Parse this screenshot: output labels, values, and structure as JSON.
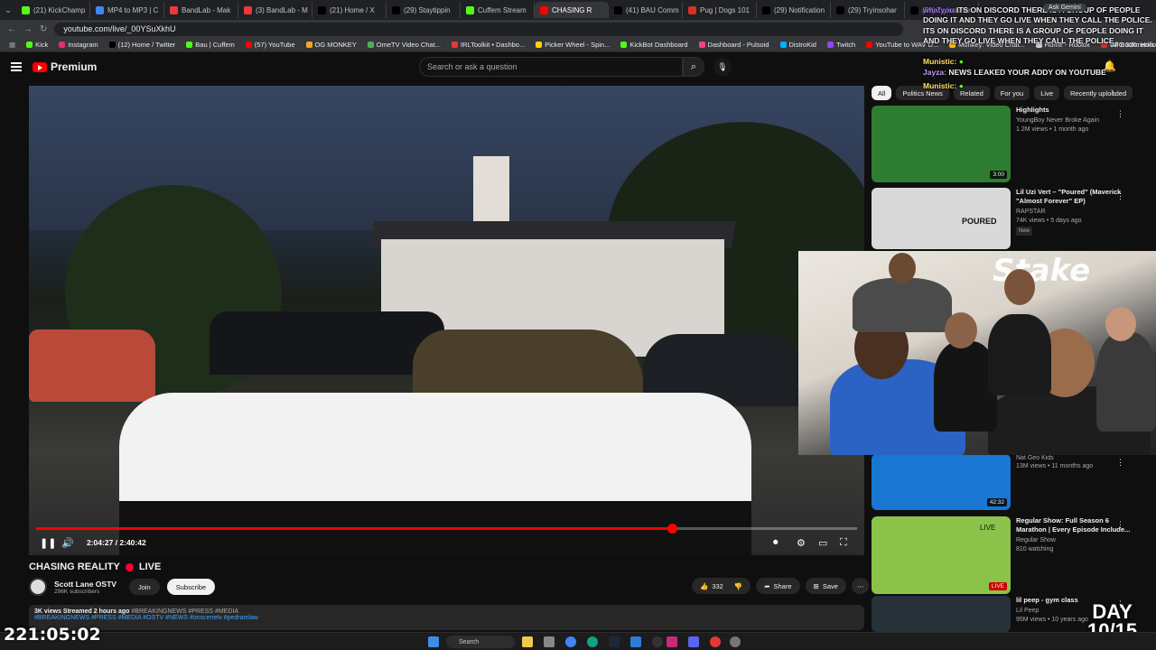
{
  "browser": {
    "tabs": [
      {
        "label": "(21) KickChamp",
        "color": "#53fc18"
      },
      {
        "label": "MP4 to MP3 | C",
        "color": "#4285f4"
      },
      {
        "label": "BandLab - Mak",
        "color": "#f0373c"
      },
      {
        "label": "(3) BandLab - M",
        "color": "#f0373c"
      },
      {
        "label": "(21) Home / X",
        "color": "#000000"
      },
      {
        "label": "(29) Staytippin",
        "color": "#000000"
      },
      {
        "label": "Cuffem Stream",
        "color": "#53fc18"
      },
      {
        "label": "CHASING R",
        "color": "#ff0000",
        "active": true
      },
      {
        "label": "(41) BAU Comm",
        "color": "#000000"
      },
      {
        "label": "Pug | Dogs 101",
        "color": "#d93025"
      },
      {
        "label": "(29) Notification",
        "color": "#000000"
      },
      {
        "label": "(29) Tryinsohar",
        "color": "#000000"
      },
      {
        "label": "(29) Tryinsohar",
        "color": "#000000"
      }
    ],
    "url": "youtube.com/live/_00YSuXkhU",
    "ask_gemini": "Ask Gemini",
    "bookmarks": [
      {
        "label": "Kick",
        "color": "#53fc18"
      },
      {
        "label": "Instagram",
        "color": "#e1306c"
      },
      {
        "label": "(12) Home / Twitter",
        "color": "#000000"
      },
      {
        "label": "Bau | Cuffem",
        "color": "#53fc18"
      },
      {
        "label": "(57) YouTube",
        "color": "#ff0000"
      },
      {
        "label": "OG MONKEY",
        "color": "#f5a623"
      },
      {
        "label": "OmeTV Video Chat...",
        "color": "#4caf50"
      },
      {
        "label": "IRLToolkit • Dashbo...",
        "color": "#e53935"
      },
      {
        "label": "Picker Wheel - Spin...",
        "color": "#ffd600"
      },
      {
        "label": "KickBot Dashboard",
        "color": "#53fc18"
      },
      {
        "label": "Dashboard - Pulsoid",
        "color": "#ff4081"
      },
      {
        "label": "DistroKid",
        "color": "#00b0ff"
      },
      {
        "label": "Twitch",
        "color": "#9146ff"
      },
      {
        "label": "YouTube to WAV D...",
        "color": "#ff0000"
      },
      {
        "label": "Monkey: Video Chat...",
        "color": "#ffb300"
      },
      {
        "label": "Home - Roblox",
        "color": "#cccccc"
      },
      {
        "label": "UFC 326: Holloway...",
        "color": "#d32f2f"
      }
    ],
    "all_bookmarks": "All Bookmarks"
  },
  "youtube": {
    "logo_text": "Premium",
    "search_placeholder": "Search or ask a question"
  },
  "player": {
    "time": "2:04:27 / 2:40:42",
    "progress": 0.775
  },
  "video_info": {
    "title": "CHASING REALITY",
    "live_label": "LIVE",
    "channel": "Scott Lane OSTV",
    "subscribers": "296K subscribers",
    "join": "Join",
    "subscribe": "Subscribe",
    "likes": "332",
    "share": "Share",
    "save": "Save",
    "stats": "3K views  Streamed 2 hours ago",
    "stats_tags": "#BREAKINGNEWS #PRESS #MEDIA",
    "tags": "#BREAKINGNEWS #PRESS #MEDIA #OSTV #NEWS #onscenetv #pedramlaw"
  },
  "sidebar": {
    "chips": [
      {
        "label": "All",
        "active": true
      },
      {
        "label": "Politics News"
      },
      {
        "label": "Related"
      },
      {
        "label": "For you"
      },
      {
        "label": "Live"
      },
      {
        "label": "Recently uploaded"
      }
    ],
    "recommendations": [
      {
        "title": "Highlights",
        "channel": "YoungBoy Never Broke Again",
        "meta": "1.2M views • 1 month ago",
        "duration": "3:00",
        "thumb_color": "#2e7d32"
      },
      {
        "title": "Lil Uzi Vert – \"Poured\" (Maverick \"Almost Forever\" EP)",
        "channel": "RAPSTAR",
        "meta": "74K views • 5 days ago",
        "badge": "New",
        "thumb_color": "#d9d9d9",
        "thumb_text": "POURED"
      },
      {
        "title": "",
        "channel": "Nat Geo Kids",
        "meta": "13M views • 11 months ago",
        "duration": "42:32",
        "thumb_color": "#1976d2"
      },
      {
        "title": "Regular Show: Full Season 6 Marathon | Every Episode Include...",
        "channel": "Regular Show",
        "meta": "810 watching",
        "duration": "LIVE",
        "thumb_color": "#8bc34a",
        "thumb_text": "LIVE"
      },
      {
        "title": "lil peep - gym class",
        "channel": "Lil Peep",
        "meta": "95M views • 10 years ago",
        "thumb_color": "#263238"
      }
    ]
  },
  "overlay": {
    "chat": [
      {
        "user": "whatyou",
        "text": "ITS ON DISCORD THERE IS A GROUP OF PEOPLE DOING IT AND THEY GO LIVE WHEN THEY CALL THE POLICE. ITS ON DISCORD THERE IS A GROUP OF PEOPLE DOING IT AND THEY GO LIVE WHEN THEY CALL THE POLICE"
      },
      {
        "user": "Munistic:",
        "text": ""
      },
      {
        "user": "Jayza:",
        "text": "NEWS LEAKED YOUR ADDY ON YOUTUBE"
      },
      {
        "user": "Munistic:",
        "text": ""
      }
    ],
    "webcam_brand": "Stake",
    "day_line1": "DAY",
    "day_line2": "10/15",
    "timer": "221:05:02"
  },
  "taskbar": {
    "search": "Search"
  }
}
